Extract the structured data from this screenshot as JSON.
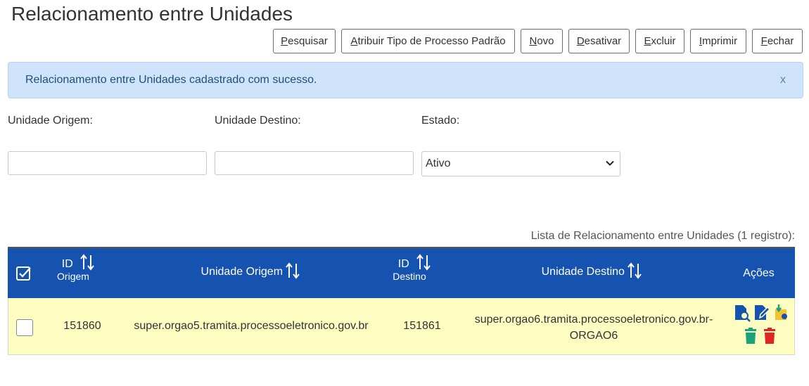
{
  "page": {
    "title": "Relacionamento entre Unidades"
  },
  "toolbar": {
    "buttons": [
      {
        "accel": "P",
        "rest": "esquisar"
      },
      {
        "accel": "A",
        "rest": "tribuir Tipo de Processo Padrão"
      },
      {
        "accel": "N",
        "rest": "ovo"
      },
      {
        "accel": "D",
        "rest": "esativar"
      },
      {
        "accel": "E",
        "rest": "xcluir"
      },
      {
        "accel": "I",
        "rest": "mprimir"
      },
      {
        "accel": "F",
        "rest": "echar"
      }
    ]
  },
  "alert": {
    "message": "Relacionamento entre Unidades cadastrado com sucesso.",
    "close": "x"
  },
  "filters": {
    "origem_label": "Unidade Origem:",
    "destino_label": "Unidade Destino:",
    "estado_label": "Estado:",
    "origem_value": "",
    "destino_value": "",
    "estado_value": "Ativo"
  },
  "list": {
    "caption": "Lista de Relacionamento entre Unidades (1 registro):",
    "headers": {
      "id_origem_top": "ID",
      "id_origem_bottom": "Origem",
      "unidade_origem": "Unidade Origem",
      "id_destino_top": "ID",
      "id_destino_bottom": "Destino",
      "unidade_destino": "Unidade Destino",
      "acoes": "Ações"
    },
    "rows": [
      {
        "id_origem": "151860",
        "unidade_origem": "super.orgao5.tramita.processoeletronico.gov.br",
        "id_destino": "151861",
        "unidade_destino_line1": "super.orgao6.tramita.processoeletronico.gov.br-",
        "unidade_destino_line2": "ORGAO6"
      }
    ]
  },
  "colors": {
    "header_bg": "#1652b0",
    "row_bg": "#fdfdc2",
    "alert_bg": "#cfe4fb",
    "icon_blue": "#1652b0",
    "icon_green": "#1aa37a",
    "icon_red": "#e02525",
    "icon_yellow": "#f2c230"
  },
  "icons": [
    "select-all-checkbox-icon",
    "sort-icon",
    "consult-icon",
    "edit-icon",
    "assign-process-type-icon",
    "deactivate-icon",
    "delete-icon"
  ]
}
